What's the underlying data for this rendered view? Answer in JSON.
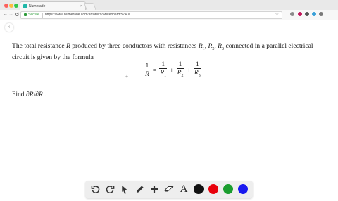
{
  "browser": {
    "tab_title": "Numerade",
    "tab_close": "×",
    "address": {
      "secure_label": "Secure",
      "url": "https://www.numerade.com/answers/whiteboard/5740/"
    },
    "menu_glyph": "⋮",
    "back_glyph": "←",
    "forward_glyph": "→",
    "reload_glyph": "C",
    "star_glyph": "☆"
  },
  "page": {
    "collapse_glyph": "‹",
    "paragraph": {
      "part1": "The total resistance ",
      "R": "R",
      "part2": " produced by three conductors with resistances ",
      "R1": "R",
      "sub1": "1",
      "comma1": ", ",
      "R2": "R",
      "sub2": "2",
      "comma2": ", ",
      "R3": "R",
      "sub3": "3",
      "part3": " connected in a parallel electrical circuit is given by the formula"
    },
    "formula": {
      "lhs_num": "1",
      "lhs_den": "R",
      "equals": "=",
      "t1_num": "1",
      "t1_den": "R",
      "t1_sub": "1",
      "plus1": "+",
      "t2_num": "1",
      "t2_den": "R",
      "t2_sub": "2",
      "plus2": "+",
      "t3_num": "1",
      "t3_den": "R",
      "t3_sub": "3"
    },
    "find": {
      "prefix": "Find ∂",
      "R": "R",
      "slash": "/∂",
      "R1": "R",
      "sub": "1",
      "period": "."
    },
    "stray_mark": "+"
  },
  "toolbar": {
    "undo_icon": "undo-icon",
    "redo_icon": "redo-icon",
    "select_icon": "pointer-icon",
    "pen_icon": "pencil-icon",
    "add_icon": "plus-icon",
    "eraser_icon": "eraser-icon",
    "text_label": "A",
    "colors": [
      "#111111",
      "#e8000b",
      "#1a9d2f",
      "#1919ef"
    ]
  }
}
